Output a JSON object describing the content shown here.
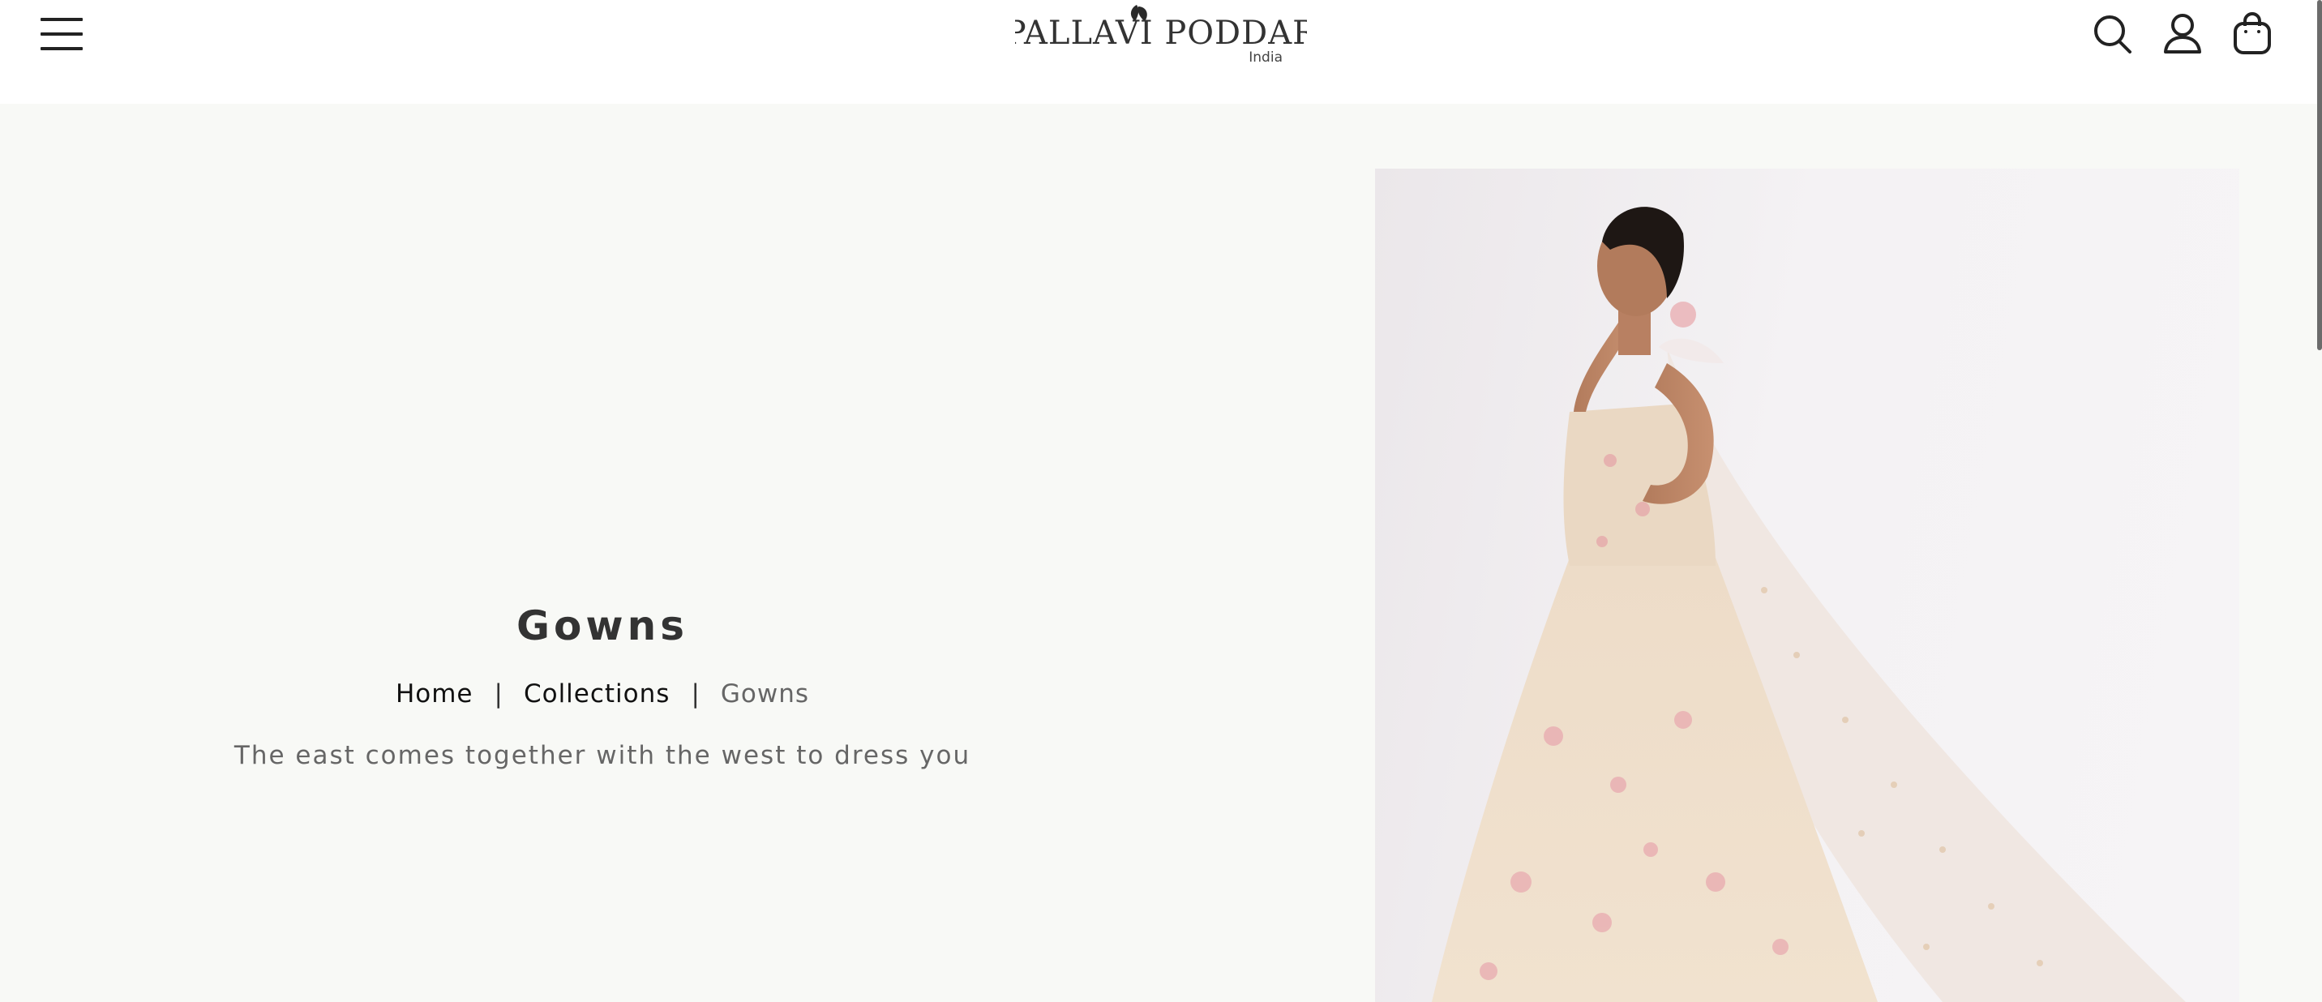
{
  "header": {
    "logo_text": "PALLAVI PODDAR",
    "logo_subtext": "India",
    "icons": [
      "menu-icon",
      "search-icon",
      "account-icon",
      "bag-icon"
    ]
  },
  "banner": {
    "title": "Gowns",
    "breadcrumb": [
      {
        "label": "Home"
      },
      {
        "label": "Collections"
      },
      {
        "label": "Gowns"
      }
    ],
    "separator": "|",
    "tagline": "The east comes together with the west to dress you"
  },
  "colors": {
    "page_background": "#f8f9f6",
    "header_background": "#ffffff",
    "title": "#333333",
    "tagline": "#666666"
  }
}
